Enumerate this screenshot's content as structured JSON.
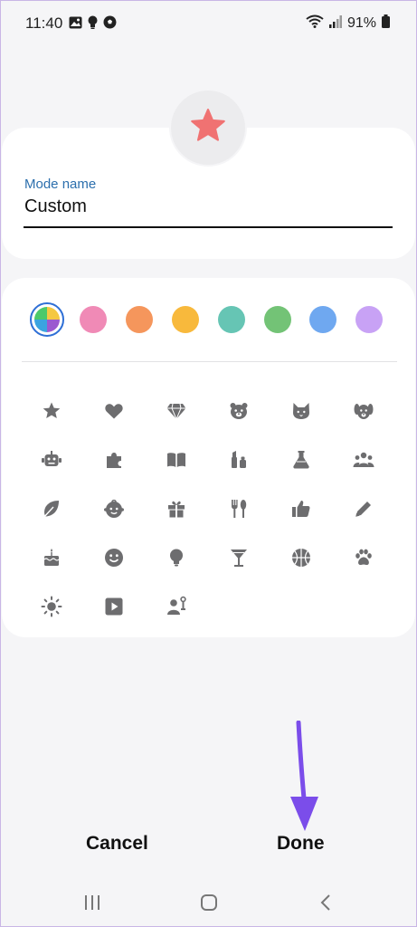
{
  "status_bar": {
    "time": "11:40",
    "battery": "91%",
    "left_icons": [
      "gallery-icon",
      "bulb-icon",
      "soccer-icon"
    ],
    "right_icons": [
      "wifi-icon",
      "signal-icon",
      "battery-icon"
    ]
  },
  "mode": {
    "icon": "star-icon",
    "icon_color": "#f07272",
    "name_label": "Mode name",
    "name_value": "Custom"
  },
  "colors": {
    "selected": "multicolor",
    "swatches": [
      "multicolor",
      "#f08ab6",
      "#f5965c",
      "#f8b93c",
      "#66c5b4",
      "#73c376",
      "#6fa8f0",
      "#c8a2f5"
    ]
  },
  "icon_grid": {
    "color": "#6d6d6f",
    "icons": [
      "star-icon",
      "heart-icon",
      "diamond-icon",
      "bear-icon",
      "cat-icon",
      "dog-icon",
      "robot-icon",
      "puzzle-icon",
      "book-icon",
      "cosmetics-icon",
      "flask-icon",
      "group-icon",
      "leaf-icon",
      "baby-icon",
      "gift-icon",
      "cutlery-icon",
      "thumbs-up-icon",
      "pencil-icon",
      "birthday-cake-icon",
      "smiley-icon",
      "lightbulb-icon",
      "cocktail-icon",
      "basketball-icon",
      "paw-icon",
      "sun-icon",
      "play-icon",
      "person-music-icon"
    ]
  },
  "actions": {
    "cancel": "Cancel",
    "done": "Done"
  },
  "annotation": {
    "arrow_color": "#7b4dea"
  },
  "navbar": {
    "items": [
      "recents-icon",
      "home-icon",
      "back-icon"
    ]
  }
}
